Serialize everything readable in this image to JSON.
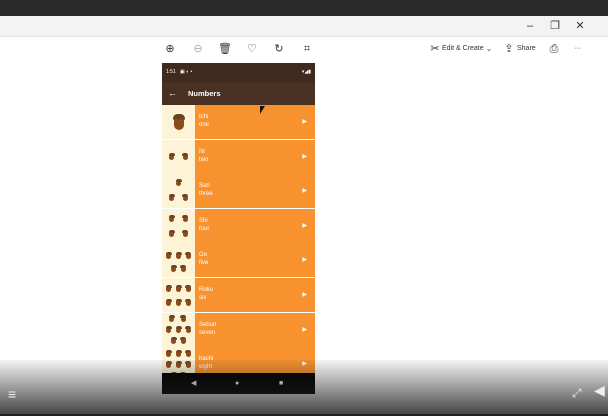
{
  "toolbar": {
    "edit_create_label": "Edit & Create",
    "share_label": "Share",
    "more_label": "···"
  },
  "phone": {
    "status_time": "1:51",
    "app_title": "Numbers",
    "rows": [
      {
        "jp": "Ichi",
        "en": "one",
        "count": 1
      },
      {
        "jp": "Ni",
        "en": "two",
        "count": 2
      },
      {
        "jp": "San",
        "en": "three",
        "count": 3
      },
      {
        "jp": "Shi",
        "en": "four",
        "count": 4
      },
      {
        "jp": "Go",
        "en": "five",
        "count": 5
      },
      {
        "jp": "Roku",
        "en": "six",
        "count": 6
      },
      {
        "jp": "Sebun",
        "en": "seven",
        "count": 7
      },
      {
        "jp": "hachi",
        "en": "eight",
        "count": 8
      }
    ]
  },
  "colors": {
    "brand_dark": "#4a3022",
    "row_orange": "#f7922e",
    "thumb_cream": "#fdf3d6"
  }
}
